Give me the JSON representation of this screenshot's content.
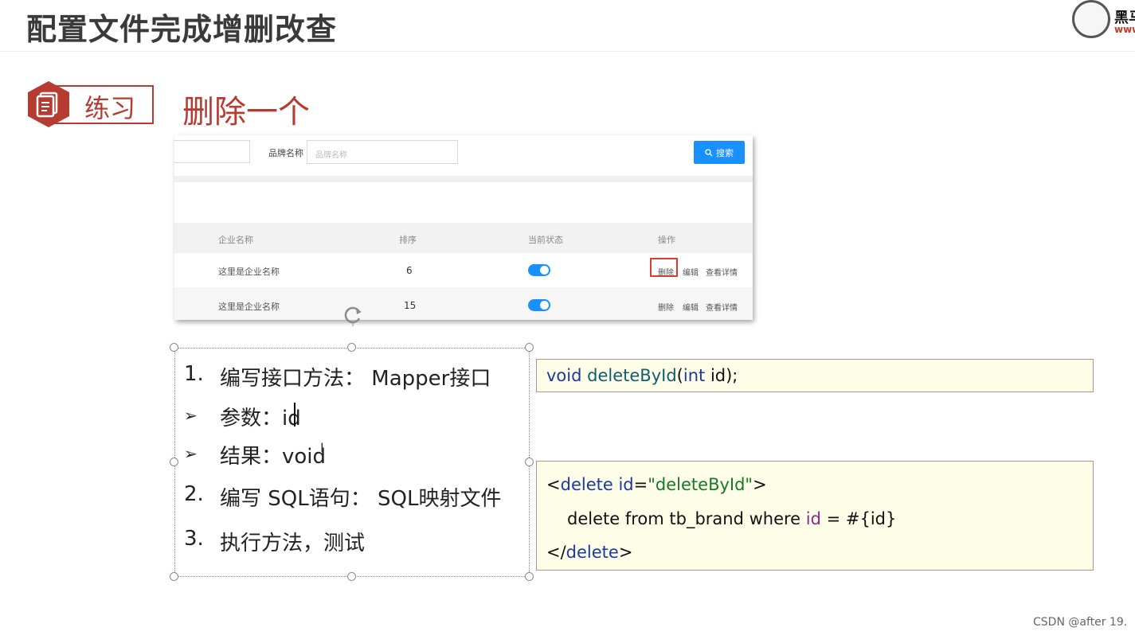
{
  "header": {
    "title": "配置文件完成增删改查",
    "logo_text": "黑马",
    "logo_url": "www"
  },
  "badge": {
    "label": "练习",
    "icon": "document-icon"
  },
  "section": {
    "heading": "删除一个"
  },
  "screenshot": {
    "brand_label": "品牌名称",
    "brand_placeholder": "品牌名称",
    "search_button": "搜索",
    "columns": [
      "企业名称",
      "排序",
      "当前状态",
      "操作"
    ],
    "rows": [
      {
        "company": "这里是企业名称",
        "order": "6",
        "status_on": true
      },
      {
        "company": "这里是企业名称",
        "order": "15",
        "status_on": true
      }
    ],
    "actions": {
      "delete": "删除",
      "edit": "编辑",
      "view": "查看详情"
    }
  },
  "steps": {
    "s1_num": "1.",
    "s1_text": "编写接口方法： Mapper接口",
    "sub1": "参数：id",
    "sub2": "结果：void",
    "s2_num": "2.",
    "s2_text": "编写 SQL语句： SQL映射文件",
    "s3_num": "3.",
    "s3_text": "执行方法，测试"
  },
  "code": {
    "line1_void": "void",
    "line1_method": "deleteById",
    "line1_open": "(",
    "line1_int": "int",
    "line1_rest": " id);",
    "xml_open_lt": "<",
    "xml_tag": "delete",
    "xml_attr": "id",
    "xml_eq": "=",
    "xml_val": "\"deleteById\"",
    "xml_gt": ">",
    "sql_pre": "delete from tb_brand where ",
    "sql_id": "id",
    "sql_post": " = #{id}",
    "xml_close_lt": "</",
    "xml_close_tag": "delete",
    "xml_close_gt": ">"
  },
  "watermark": "CSDN @after 19."
}
